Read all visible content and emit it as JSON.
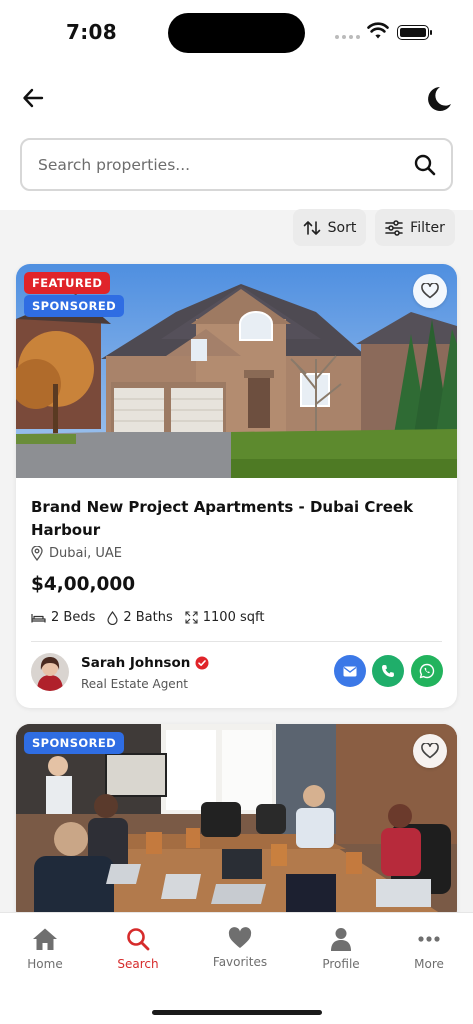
{
  "status_bar": {
    "time": "7:08"
  },
  "search": {
    "placeholder": "Search properties..."
  },
  "toolbar": {
    "sort_label": "Sort",
    "filter_label": "Filter"
  },
  "listings": [
    {
      "badges": {
        "featured": "FEATURED",
        "sponsored": "SPONSORED"
      },
      "title": "Brand New Project Apartments - Dubai Creek Harbour",
      "location": "Dubai, UAE",
      "price": "$4,00,000",
      "beds": "2 Beds",
      "baths": "2 Baths",
      "area": "1100 sqft",
      "agent": {
        "name": "Sarah Johnson",
        "role": "Real Estate Agent"
      }
    },
    {
      "badges": {
        "sponsored": "SPONSORED"
      }
    }
  ],
  "bottom_nav": {
    "items": [
      {
        "label": "Home",
        "icon": "home-icon"
      },
      {
        "label": "Search",
        "icon": "search-icon"
      },
      {
        "label": "Favorites",
        "icon": "heart-icon"
      },
      {
        "label": "Profile",
        "icon": "person-icon"
      },
      {
        "label": "More",
        "icon": "more-icon"
      }
    ],
    "active": "Search"
  },
  "colors": {
    "accent": "#d62b2b",
    "featured_badge": "#e0242a",
    "sponsored_badge": "#2f6de3",
    "email": "#3b78e7",
    "phone": "#1fae6a",
    "whatsapp": "#22b35d"
  }
}
